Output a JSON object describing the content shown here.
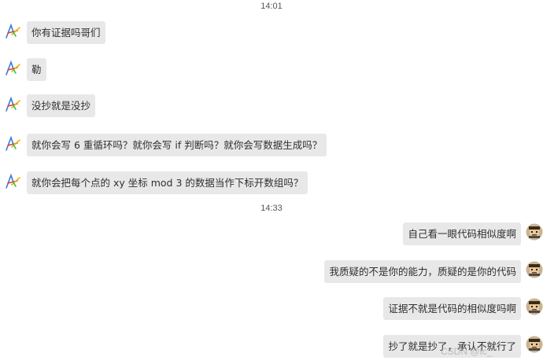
{
  "timestamps": [
    "14:01",
    "14:33"
  ],
  "messages_left": [
    {
      "text": "你有证据吗哥们"
    },
    {
      "text": "勒"
    },
    {
      "text": "没抄就是没抄"
    },
    {
      "text": "就你会写 6 重循环吗？就你会写 if 判断吗？就你会写数据生成吗？"
    },
    {
      "text": "就你会把每个点的 xy 坐标 mod 3 的数据当作下标开数组吗？"
    }
  ],
  "messages_right": [
    {
      "text": "自己看一眼代码相似度啊"
    },
    {
      "text": "我质疑的不是你的能力，质疑的是你的代码"
    },
    {
      "text": "证据不就是代码的相似度吗啊"
    },
    {
      "text": "抄了就是抄了，承认不就行了"
    }
  ],
  "watermark": "CSDN @tc_",
  "icons": {
    "left_avatar": "colorful-a-logo-icon",
    "right_avatar": "pixel-face-icon"
  }
}
